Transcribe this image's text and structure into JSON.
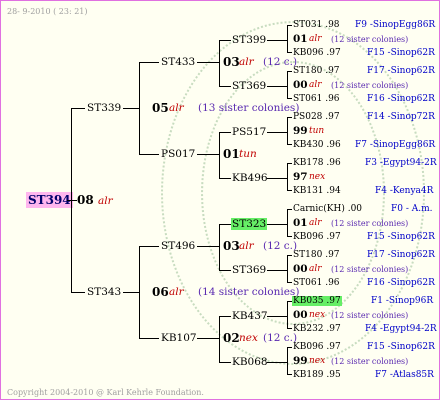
{
  "header": {
    "date": "28-  9-2010 ( 23: 21)"
  },
  "footer": {
    "copyright": "Copyright 2004-2010 @ Karl Kehrle Foundation."
  },
  "root": {
    "name": "ST394",
    "gen": "08",
    "mark": "alr"
  },
  "gen1": [
    {
      "name": "ST339",
      "gen": "05",
      "mark": "alr",
      "note": "(13 sister colonies)"
    },
    {
      "name": "ST343",
      "gen": "06",
      "mark": "alr",
      "note": "(14 sister colonies)"
    }
  ],
  "gen2": [
    {
      "name": "ST433",
      "gen": "03",
      "mark": "alr",
      "note": "(12 c.)"
    },
    {
      "name": "PS017",
      "gen": "01",
      "mark": "tun",
      "note": ""
    },
    {
      "name": "ST496",
      "gen": "03",
      "mark": "alr",
      "note": "(12 c.)"
    },
    {
      "name": "KB107",
      "gen": "02",
      "mark": "nex",
      "note": "(12 c.)"
    }
  ],
  "gen3": [
    {
      "name": "ST399",
      "highlight": false
    },
    {
      "name": "ST369",
      "highlight": false
    },
    {
      "name": "PS517",
      "highlight": false
    },
    {
      "name": "KB496",
      "highlight": false
    },
    {
      "name": "ST323",
      "highlight": true
    },
    {
      "name": "ST369",
      "highlight": false
    },
    {
      "name": "KB437",
      "highlight": false
    },
    {
      "name": "KB068",
      "highlight": false
    }
  ],
  "gen4": [
    {
      "top": "ST031 .98",
      "top_src": "F9 -SinopEgg86R",
      "mid_gen": "01",
      "mid_mark": "alr",
      "mid_note": "(12 sister colonies)",
      "bot": "KB096 .97",
      "bot_src": "F15 -Sinop62R"
    },
    {
      "top": "ST180 .97",
      "top_src": "F17 -Sinop62R",
      "mid_gen": "00",
      "mid_mark": "alr",
      "mid_note": "(12 sister colonies)",
      "bot": "ST061 .96",
      "bot_src": "F16 -Sinop62R"
    },
    {
      "top": "PS028 .97",
      "top_src": "F14 -Sinop72R",
      "mid_gen": "99",
      "mid_mark": "tun",
      "mid_note": "",
      "bot": "KB430 .96",
      "bot_src": "F7 -SinopEgg86R"
    },
    {
      "top": "KB178 .96",
      "top_src": "F3 -Egypt94-2R",
      "mid_gen": "97",
      "mid_mark": "nex",
      "mid_note": "",
      "bot": "KB131 .94",
      "bot_src": "F4 -Kenya4R"
    },
    {
      "top": "Carnic(KH) .00",
      "top_src": "F0 - A.m.",
      "mid_gen": "01",
      "mid_mark": "alr",
      "mid_note": "(12 sister colonies)",
      "bot": "KB096 .97",
      "bot_src": "F15 -Sinop62R"
    },
    {
      "top": "ST180 .97",
      "top_src": "F17 -Sinop62R",
      "mid_gen": "00",
      "mid_mark": "alr",
      "mid_note": "(12 sister colonies)",
      "bot": "ST061 .96",
      "bot_src": "F16 -Sinop62R"
    },
    {
      "top": "KB035 .97",
      "top_hl": true,
      "top_src": "F1 -Sinop96R",
      "mid_gen": "00",
      "mid_mark": "nex",
      "mid_note": "(12 sister colonies)",
      "bot": "KB232 .97",
      "bot_src": "F4 -Egypt94-2R"
    },
    {
      "top": "KB096 .97",
      "top_src": "F15 -Sinop62R",
      "mid_gen": "99",
      "mid_mark": "nex",
      "mid_note": "(12 sister colonies)",
      "bot": "KB189 .95",
      "bot_src": "F7 -Atlas85R"
    }
  ]
}
